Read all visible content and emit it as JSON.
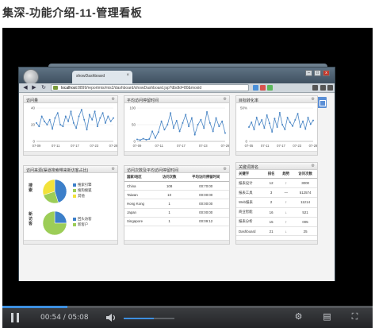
{
  "page_title": "集深-功能介绍-11-管理看板",
  "browser": {
    "tab_title": "showDashboard",
    "url_host": "localhost",
    "url_rest": ":8899/reportmis/mis2/dashboard/showDashboard.jsp?dbdId=80&moxid",
    "win_buttons": [
      "–",
      "□",
      "x"
    ]
  },
  "panels": {
    "p1": {
      "title": "访问量",
      "chart_data": {
        "type": "line",
        "y_ticks": [
          "40",
          "20",
          "0"
        ],
        "ylim": [
          0,
          40
        ],
        "x_labels": [
          "07-09",
          "07-11",
          "07-17",
          "07-23",
          "07-29"
        ],
        "values": [
          22,
          18,
          30,
          24,
          20,
          26,
          15,
          28,
          34,
          20,
          18,
          30,
          24,
          36,
          22,
          16,
          30,
          38,
          26,
          14,
          32,
          26,
          36,
          18,
          28,
          34,
          22,
          30,
          24,
          28
        ]
      }
    },
    "p2": {
      "title": "平均访问停留时间",
      "chart_data": {
        "type": "line",
        "y_ticks": [
          "100",
          "50",
          "0"
        ],
        "ylim": [
          0,
          100
        ],
        "x_labels": [
          "07-09",
          "07-11",
          "07-17",
          "07-23",
          "07-29"
        ],
        "values": [
          6,
          4,
          8,
          5,
          7,
          30,
          10,
          28,
          60,
          35,
          50,
          85,
          40,
          62,
          30,
          55,
          80,
          45,
          70,
          20,
          50,
          65,
          40,
          88,
          55,
          30,
          70,
          45,
          60,
          25
        ]
      }
    },
    "p3": {
      "title": "目标转化率",
      "chart_data": {
        "type": "line",
        "y_ticks": [
          "50%",
          "0"
        ],
        "ylim": [
          0,
          70
        ],
        "x_labels": [
          "07-05",
          "07-11",
          "07-17",
          "07-23",
          "07-29"
        ],
        "values": [
          30,
          40,
          25,
          50,
          35,
          45,
          28,
          55,
          38,
          20,
          48,
          30,
          60,
          35,
          25,
          50,
          40,
          32,
          45,
          58,
          30,
          42,
          26,
          50,
          36,
          44
        ]
      }
    },
    "p4": {
      "title": "访问来源(渠道搜索带来新访客占比)",
      "pie1": {
        "label": "搜索",
        "legend": [
          "搜索引擎",
          "搜狗搜狐",
          "其他"
        ],
        "colors": [
          "#3c7fc9",
          "#9ccd57",
          "#f2e23a"
        ],
        "values": [
          45,
          25,
          30
        ]
      },
      "pie2": {
        "label": "新访客",
        "legend": [
          "回头访客",
          "新客户"
        ],
        "colors": [
          "#3c7fc9",
          "#9ccd57"
        ],
        "values": [
          25,
          75
        ]
      }
    },
    "p5": {
      "title": "访问次数及平均访问停留时间",
      "headers": [
        "国家/地区",
        "访问次数",
        "平均访问停留时间"
      ],
      "rows": [
        [
          "China",
          "108",
          "00:70:00"
        ],
        [
          "Taiwan",
          "10",
          "00:00:00"
        ],
        [
          "Hong Kong",
          "1",
          "00:00:00"
        ],
        [
          "Japan",
          "1",
          "00:00:00"
        ],
        [
          "Singapore",
          "1",
          "00:09:12"
        ]
      ]
    },
    "p6": {
      "title": "关键词排名",
      "headers": [
        "关键字",
        "排名",
        "趋势",
        "访问次数"
      ],
      "rows": [
        [
          "报表设计",
          "12",
          "↑",
          "3000"
        ],
        [
          "报表工具",
          "3",
          "—",
          "512574"
        ],
        [
          "Web报表",
          "2",
          "↑",
          "11214"
        ],
        [
          "商业智能",
          "16",
          "↓",
          "521"
        ],
        [
          "报表分析",
          "15",
          "↑",
          "005"
        ],
        [
          "Dashboard",
          "21",
          "↓",
          "25"
        ]
      ]
    }
  },
  "player": {
    "time": "00:54 / 05:08",
    "progress_fraction": 0.175,
    "volume_fraction": 0.6,
    "icons": [
      "pause-icon",
      "volume-icon",
      "settings-icon",
      "subtitle-icon",
      "fullscreen-icon"
    ]
  }
}
